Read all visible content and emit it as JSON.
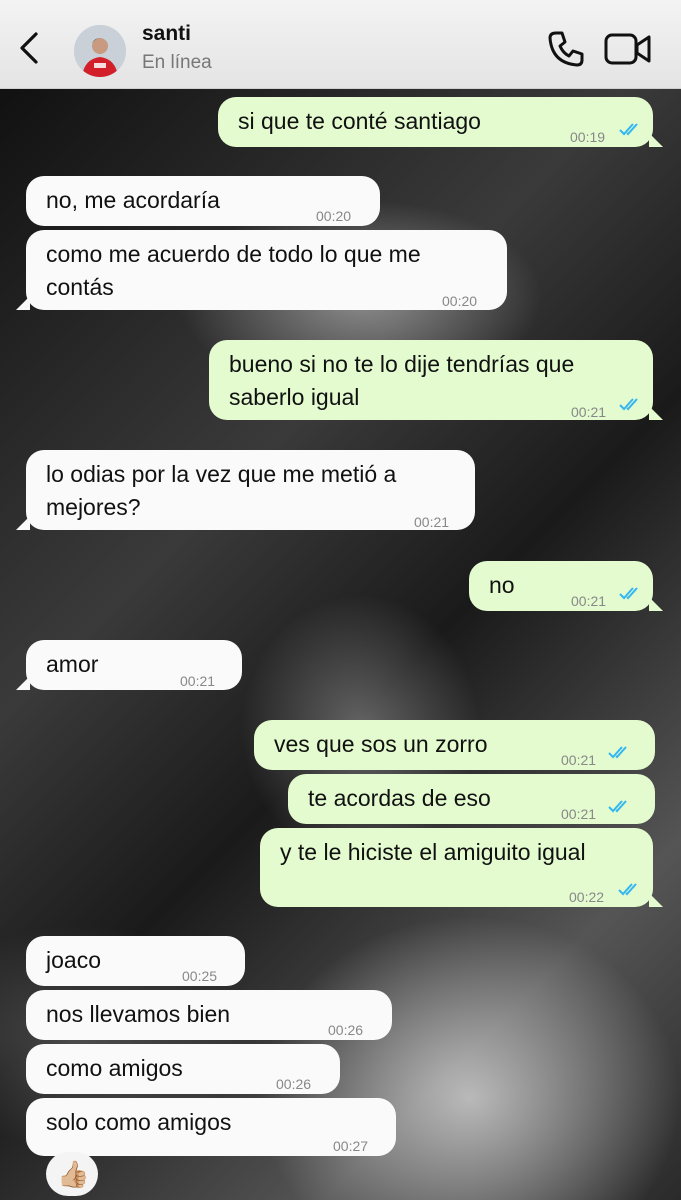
{
  "header": {
    "contact_name": "santi",
    "contact_status": "En línea"
  },
  "messages": [
    {
      "direction": "out",
      "text": "si que te conté santiago",
      "time": "00:19",
      "read": true
    },
    {
      "direction": "in",
      "text": "no, me acordaría",
      "time": "00:20"
    },
    {
      "direction": "in",
      "text": "como me acuerdo de todo lo que me\ncontás",
      "time": "00:20"
    },
    {
      "direction": "out",
      "text": "bueno si no te lo dije tendrías que\nsaberlo igual",
      "time": "00:21",
      "read": true
    },
    {
      "direction": "in",
      "text": "lo odias por la vez que me metió a\nmejores?",
      "time": "00:21"
    },
    {
      "direction": "out",
      "text": "no",
      "time": "00:21",
      "read": true
    },
    {
      "direction": "in",
      "text": "amor",
      "time": "00:21"
    },
    {
      "direction": "out",
      "text": "ves que sos un zorro",
      "time": "00:21",
      "read": true
    },
    {
      "direction": "out",
      "text": "te acordas de eso",
      "time": "00:21",
      "read": true
    },
    {
      "direction": "out",
      "text": "y te le hiciste el amiguito igual",
      "time": "00:22",
      "read": true
    },
    {
      "direction": "in",
      "text": "joaco",
      "time": "00:25"
    },
    {
      "direction": "in",
      "text": "nos llevamos bien",
      "time": "00:26"
    },
    {
      "direction": "in",
      "text": "como amigos",
      "time": "00:26"
    },
    {
      "direction": "in",
      "text": "solo como amigos",
      "time": "00:27"
    }
  ],
  "reaction": {
    "emoji": "👍🏼"
  },
  "colors": {
    "outgoing_bubble": "#e3fbcf",
    "incoming_bubble": "#fafafa",
    "read_ticks": "#34b7f1"
  },
  "icons": [
    "back-chevron-icon",
    "phone-icon",
    "video-call-icon",
    "read-receipt-icon"
  ]
}
